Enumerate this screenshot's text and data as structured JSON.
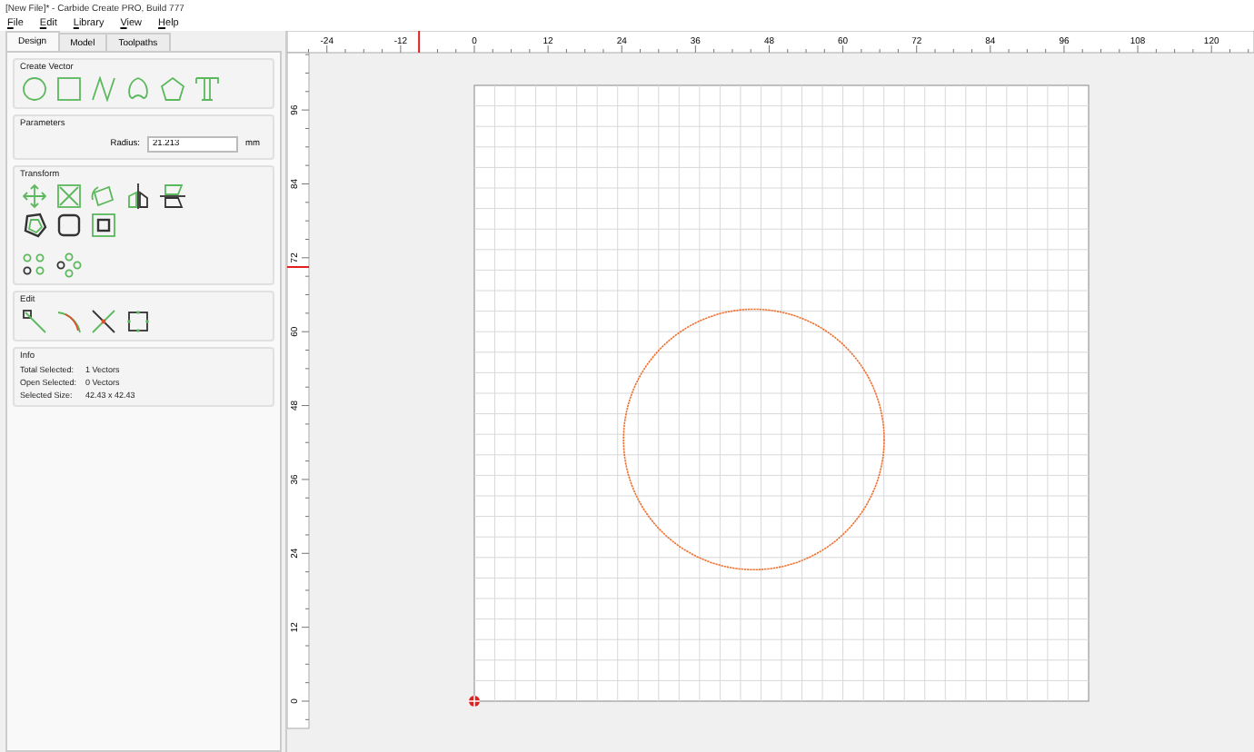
{
  "window": {
    "title": "[New File]* - Carbide Create PRO, Build 777"
  },
  "menu": [
    {
      "label": "File"
    },
    {
      "label": "Edit"
    },
    {
      "label": "Library"
    },
    {
      "label": "View"
    },
    {
      "label": "Help"
    }
  ],
  "tabs": [
    {
      "label": "Design",
      "selected": true
    },
    {
      "label": "Model",
      "selected": false
    },
    {
      "label": "Toolpaths",
      "selected": false
    }
  ],
  "sections": [
    {
      "kind": "create",
      "title": "Create Vector"
    },
    {
      "kind": "params",
      "title": "Parameters",
      "field": {
        "label": "Radius:",
        "value": "21.213",
        "unit": "mm"
      }
    },
    {
      "kind": "transform",
      "title": "Transform"
    },
    {
      "kind": "edit",
      "title": "Edit"
    },
    {
      "kind": "info",
      "title": "Info",
      "rows": [
        {
          "label": "Total Selected:",
          "value": "1 Vectors"
        },
        {
          "label": "Open Selected:",
          "value": "0 Vectors"
        },
        {
          "label": "Selected Size:",
          "value": "42.43 x 42.43"
        }
      ]
    }
  ],
  "canvas": {
    "x_ruler": [
      "-24",
      "-12",
      "0",
      "12",
      "24",
      "36",
      "48",
      "60",
      "72",
      "84",
      "96",
      "108",
      "120"
    ],
    "y_ruler": [
      "0",
      "12",
      "24",
      "36",
      "48",
      "60",
      "72",
      "84",
      "96"
    ]
  }
}
